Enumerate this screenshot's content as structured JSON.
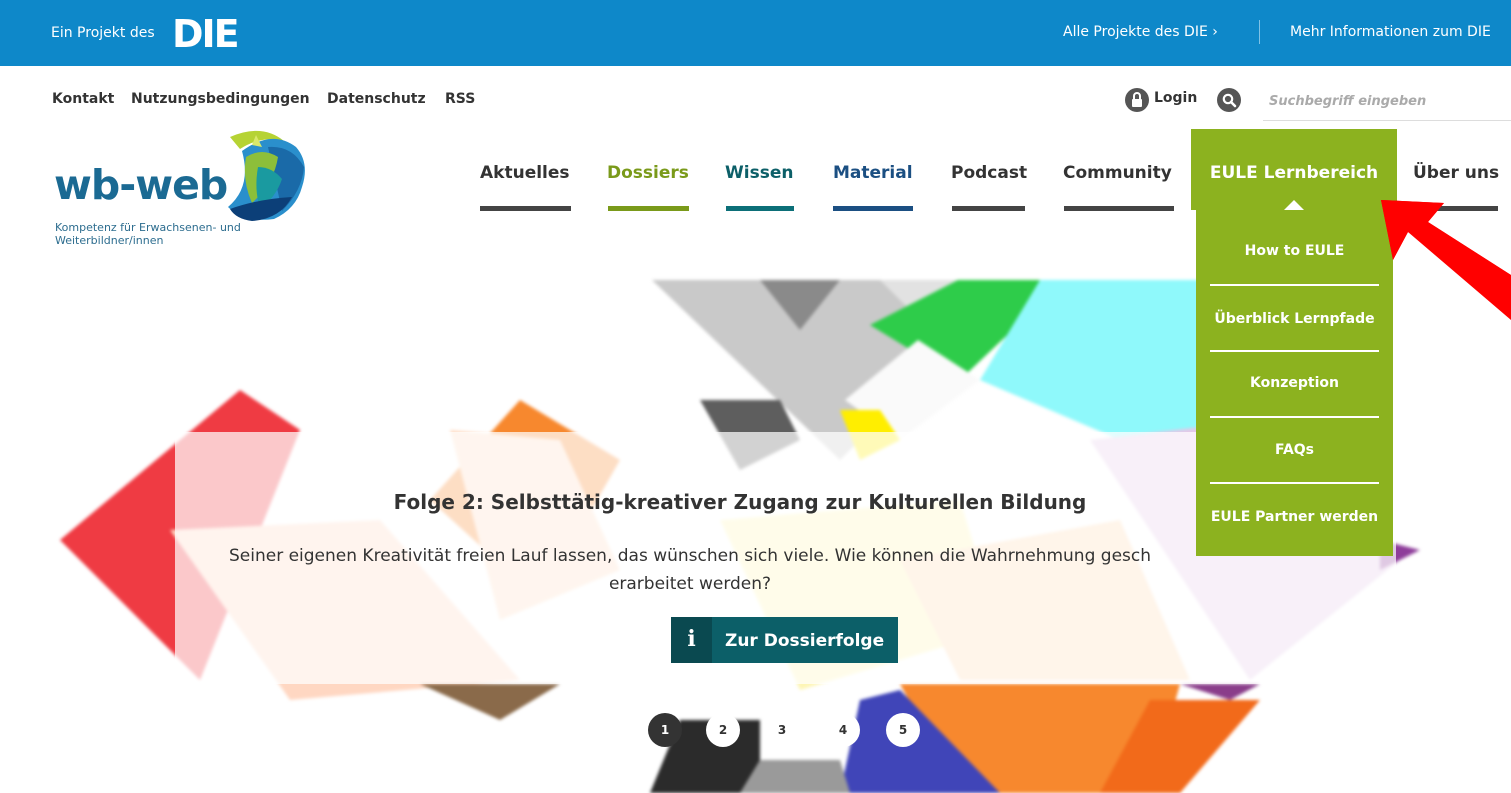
{
  "topbar": {
    "project_prefix": "Ein Projekt des",
    "die_logo": "DIE",
    "all_projects": "Alle Projekte des DIE ›",
    "more_info": "Mehr Informationen zum DIE"
  },
  "meta_links": [
    "Kontakt",
    "Nutzungsbedingungen",
    "Datenschutz",
    "RSS"
  ],
  "login_label": "Login",
  "search": {
    "placeholder": "Suchbegriff eingeben"
  },
  "logo": {
    "wordmark": "wb-web",
    "tagline": "Kompetenz für Erwachsenen- und Weiterbildner/innen"
  },
  "nav": [
    {
      "label": "Aktuelles",
      "color": "#333333"
    },
    {
      "label": "Dossiers",
      "color": "#7a9a1a"
    },
    {
      "label": "Wissen",
      "color": "#0c5f68"
    },
    {
      "label": "Material",
      "color": "#1b4f82"
    },
    {
      "label": "Podcast",
      "color": "#333333"
    },
    {
      "label": "Community",
      "color": "#333333"
    },
    {
      "label": "EULE Lernbereich",
      "color": "#8cb21f"
    },
    {
      "label": "Über uns",
      "color": "#333333"
    }
  ],
  "eule_dropdown": [
    "How to EULE",
    "Überblick Lernpfade",
    "Konzeption",
    "FAQs",
    "EULE Partner werden"
  ],
  "hero": {
    "title": "Folge 2: Selbsttätig-kreativer Zugang zur Kulturellen Bildung",
    "description": "Seiner eigenen Kreativität freien Lauf lassen, das wünschen sich viele. Wie können die Wahrnehmung gesch erarbeitet werden?",
    "cta_icon": "i",
    "cta_label": "Zur Dossierfolge"
  },
  "pagination": [
    {
      "label": "1",
      "active": true
    },
    {
      "label": "2",
      "active": false
    },
    {
      "label": "3",
      "active": false
    },
    {
      "label": "4",
      "active": false
    },
    {
      "label": "5",
      "active": false
    }
  ],
  "colors": {
    "topbar": "#0e88c9",
    "eule_green": "#8cb21f",
    "cta_teal": "#0c5f68",
    "annotation_red": "#ff0000"
  },
  "icons": [
    "login-lock-icon",
    "search-icon",
    "info-icon",
    "annotation-arrow-icon"
  ]
}
